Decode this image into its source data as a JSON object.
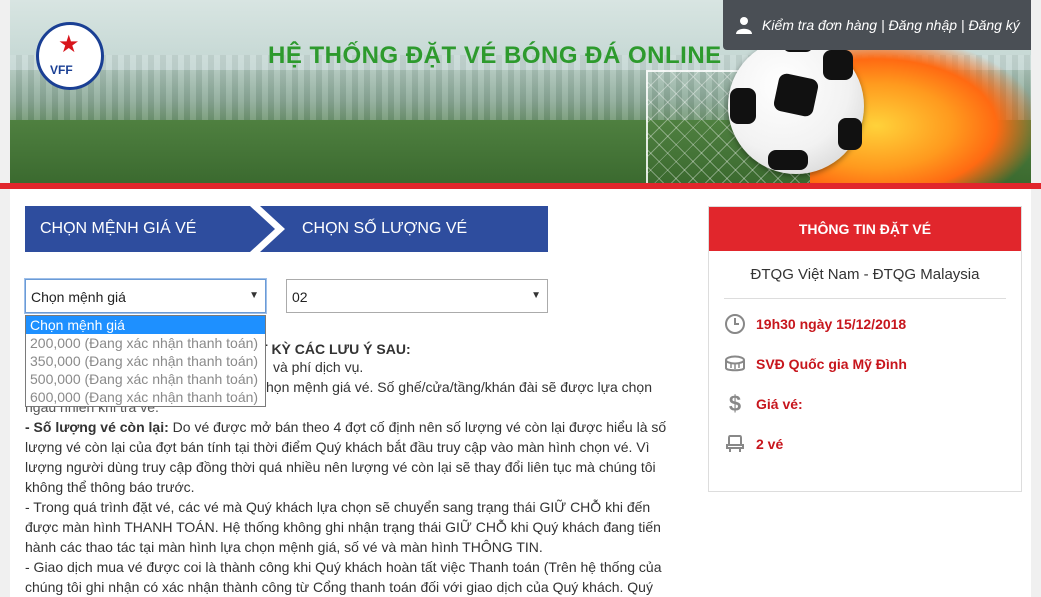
{
  "header": {
    "site_title": "HỆ THỐNG ĐẶT VÉ BÓNG ĐÁ ONLINE",
    "logo_text": "VFF",
    "nav": {
      "check_order": "Kiểm tra đơn hàng",
      "sep1": " | ",
      "login": "Đăng nhập",
      "sep2": " | ",
      "register": "Đăng ký"
    }
  },
  "steps": {
    "step1": "CHỌN MỆNH GIÁ VÉ",
    "step2": "CHỌN SỐ LƯỢNG VÉ"
  },
  "price_select": {
    "selected": "Chọn mệnh giá",
    "options": [
      "Chọn mệnh giá",
      "200,000 (Đang xác nhận thanh toán)",
      "350,000 (Đang xác nhận thanh toán)",
      "500,000 (Đang xác nhận thanh toán)",
      "600,000 (Đang xác nhận thanh toán)"
    ]
  },
  "qty_select": {
    "selected": "02"
  },
  "notes": {
    "heading": "T KỲ CÁC LƯU Ý SAU:",
    "lines": [
      {
        "lead": "",
        "text": "và phí dịch vụ."
      },
      {
        "lead": "",
        "text": "chọn mệnh giá vé. Số ghế/cửa/tầng/khán đài sẽ được lựa chọn"
      },
      {
        "lead": "",
        "text": "ngẫu nhiên khi trả vé."
      },
      {
        "lead": "- Số lượng vé còn lại:",
        "text": " Do vé được mở bán theo 4 đợt cố định nên số lượng vé còn lại được hiểu là số"
      },
      {
        "lead": "",
        "text": "lượng vé còn lại của đợt bán tính tại thời điểm Quý khách bắt đầu truy cập vào màn hình chọn vé. Vì"
      },
      {
        "lead": "",
        "text": "lượng người dùng truy cập đồng thời quá nhiều nên lượng vé còn lại sẽ thay đổi liên tục mà chúng tôi"
      },
      {
        "lead": "",
        "text": "không thể thông báo trước."
      },
      {
        "lead": "",
        "text": "- Trong quá trình đặt vé, các vé mà Quý khách lựa chọn sẽ chuyển sang trạng thái GIỮ CHỖ khi đến"
      },
      {
        "lead": "",
        "text": "được màn hình THANH TOÁN. Hệ thống không ghi nhận trạng thái GIỮ CHỖ khi Quý khách đang tiến"
      },
      {
        "lead": "",
        "text": "hành các thao tác tại màn hình lựa chọn mệnh giá, số vé và màn hình THÔNG TIN."
      },
      {
        "lead": "",
        "text": "- Giao dịch mua vé được coi là thành công khi Quý khách hoàn tất việc Thanh toán (Trên hệ thống của"
      },
      {
        "lead": "",
        "text": "chúng tôi ghi nhận có xác nhận thành công từ Cổng thanh toán đối với giao dịch của Quý khách. Quý"
      }
    ]
  },
  "booking_info": {
    "title": "THÔNG TIN ĐẶT VÉ",
    "match": "ĐTQG Việt Nam - ĐTQG Malaysia",
    "time": "19h30 ngày 15/12/2018",
    "venue": "SVĐ Quốc gia Mỹ Đình",
    "price": "Giá vé:",
    "quantity": "2 vé"
  },
  "colors": {
    "accent_red": "#e1262c",
    "step_blue": "#2e4d9e",
    "title_green": "#2d9a2d"
  }
}
